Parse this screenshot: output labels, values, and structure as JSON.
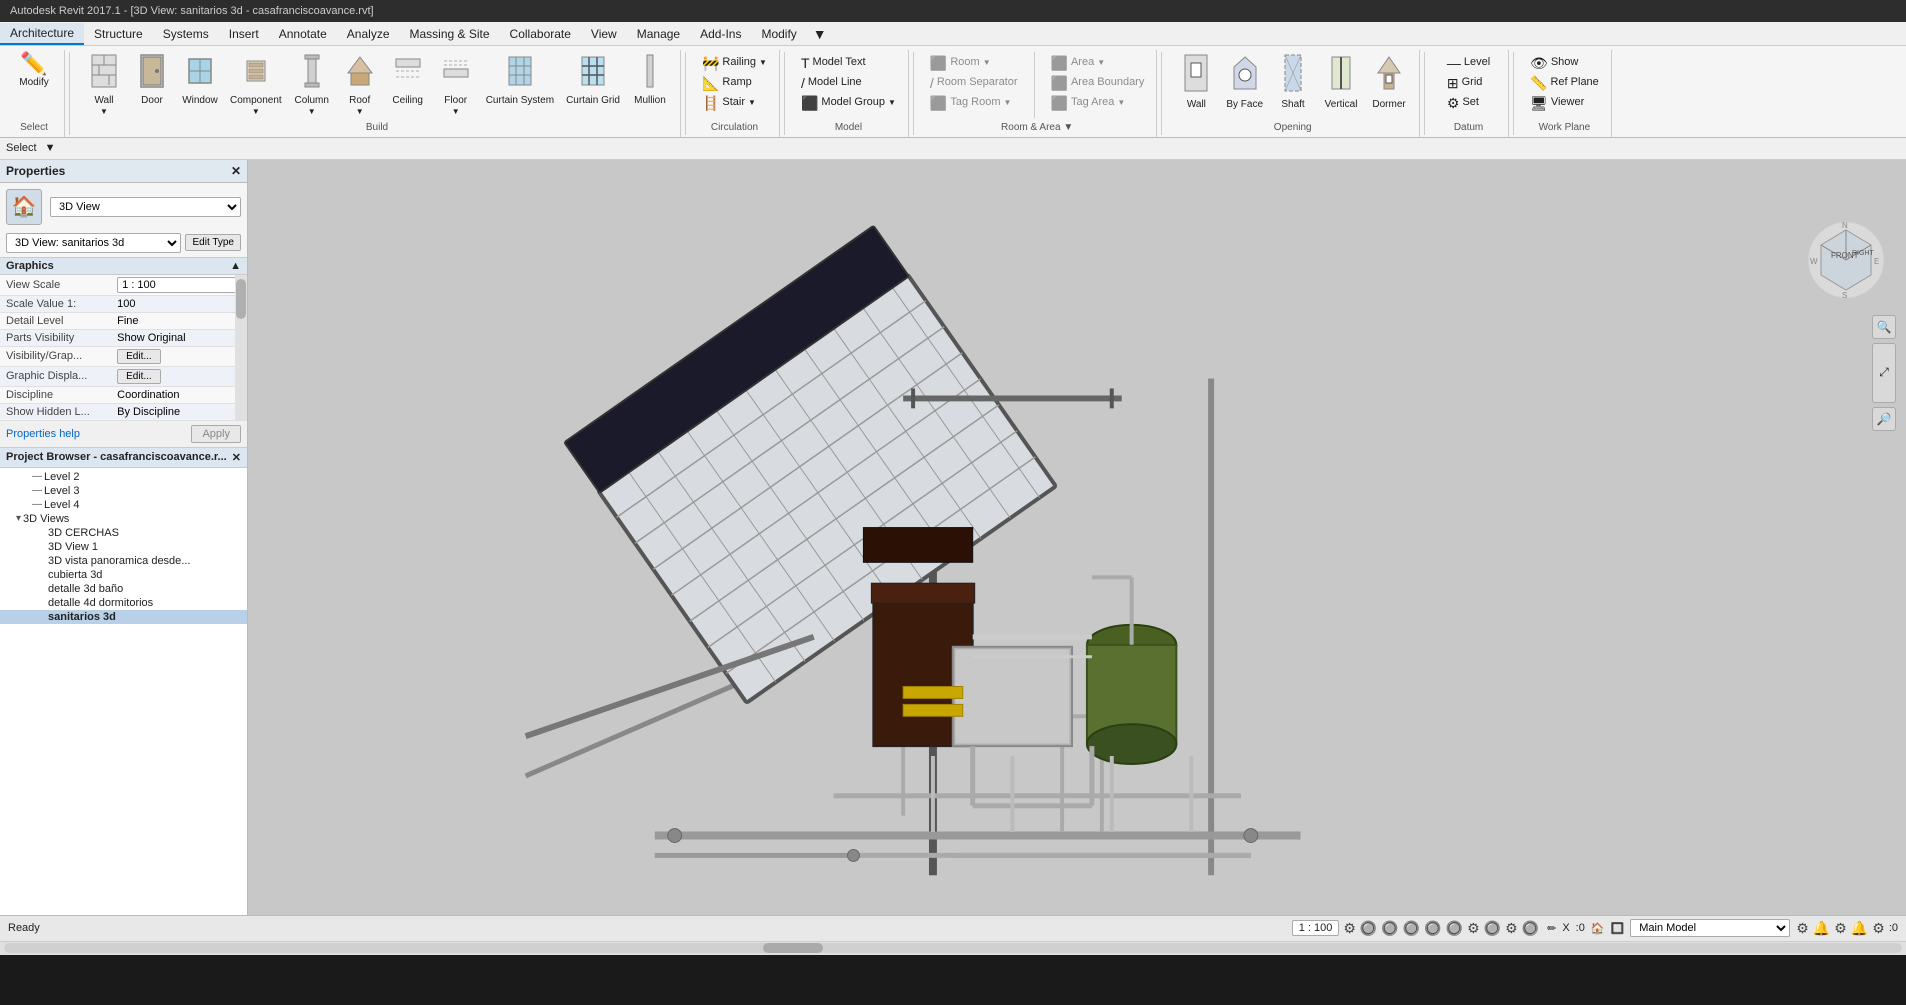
{
  "titlebar": {
    "text": "Autodesk Revit 2017.1 - [3D View: sanitarios 3d - casafranciscoavance.rvt]"
  },
  "menubar": {
    "items": [
      "Architecture",
      "Structure",
      "Systems",
      "Insert",
      "Annotate",
      "Analyze",
      "Massing & Site",
      "Collaborate",
      "View",
      "Manage",
      "Add-Ins",
      "Modify"
    ]
  },
  "ribbon": {
    "active_tab": "Architecture",
    "groups": [
      {
        "label": "Select",
        "buttons": [
          {
            "icon": "✏️",
            "label": "Modify",
            "type": "large"
          }
        ]
      },
      {
        "label": "Build",
        "buttons": [
          {
            "icon": "🧱",
            "label": "Wall",
            "type": "large"
          },
          {
            "icon": "🚪",
            "label": "Door",
            "type": "large"
          },
          {
            "icon": "🪟",
            "label": "Window",
            "type": "large"
          },
          {
            "icon": "⚙️",
            "label": "Component",
            "type": "large"
          },
          {
            "icon": "▮",
            "label": "Column",
            "type": "large"
          },
          {
            "icon": "🏠",
            "label": "Roof",
            "type": "large"
          },
          {
            "icon": "⬜",
            "label": "Ceiling",
            "type": "large"
          },
          {
            "icon": "📐",
            "label": "Floor",
            "type": "large"
          },
          {
            "icon": "▦",
            "label": "Curtain System",
            "type": "large"
          },
          {
            "icon": "▦",
            "label": "Curtain Grid",
            "type": "large"
          },
          {
            "icon": "▮",
            "label": "Mullion",
            "type": "large"
          }
        ]
      },
      {
        "label": "Circulation",
        "buttons": [
          {
            "icon": "⬛",
            "label": "Railing",
            "type": "small"
          },
          {
            "icon": "⬛",
            "label": "Ramp",
            "type": "small"
          },
          {
            "icon": "⬛",
            "label": "Stair",
            "type": "small"
          }
        ]
      },
      {
        "label": "Model",
        "buttons": [
          {
            "icon": "T",
            "label": "Model Text",
            "type": "small"
          },
          {
            "icon": "/",
            "label": "Model Line",
            "type": "small"
          },
          {
            "icon": "⬛",
            "label": "Model Group",
            "type": "small"
          }
        ]
      },
      {
        "label": "Room & Area",
        "buttons": [
          {
            "icon": "⬛",
            "label": "Room",
            "type": "small"
          },
          {
            "icon": "/",
            "label": "Room Separator",
            "type": "small"
          },
          {
            "icon": "⬛",
            "label": "Tag Room",
            "type": "small"
          },
          {
            "icon": "⬛",
            "label": "Area",
            "type": "small"
          },
          {
            "icon": "⬛",
            "label": "Area Boundary",
            "type": "small"
          },
          {
            "icon": "⬛",
            "label": "Tag Area",
            "type": "small"
          }
        ]
      },
      {
        "label": "Opening",
        "buttons": [
          {
            "icon": "⬛",
            "label": "Wall",
            "type": "small"
          },
          {
            "icon": "⬛",
            "label": "By Face",
            "type": "small"
          },
          {
            "icon": "⬛",
            "label": "Shaft",
            "type": "small"
          },
          {
            "icon": "⬛",
            "label": "Vertical",
            "type": "small"
          },
          {
            "icon": "⬛",
            "label": "Dormer",
            "type": "small"
          }
        ]
      },
      {
        "label": "Datum",
        "buttons": [
          {
            "icon": "⬛",
            "label": "Level",
            "type": "small"
          },
          {
            "icon": "⬛",
            "label": "Grid",
            "type": "small"
          },
          {
            "icon": "⬛",
            "label": "Set",
            "type": "small"
          }
        ]
      },
      {
        "label": "Work Plane",
        "buttons": [
          {
            "icon": "⬛",
            "label": "Show",
            "type": "small"
          },
          {
            "icon": "⬛",
            "label": "Ref Plane",
            "type": "small"
          },
          {
            "icon": "⬛",
            "label": "Viewer",
            "type": "small"
          }
        ]
      }
    ]
  },
  "select_bar": {
    "label": "Select",
    "dropdown_arrow": "▼"
  },
  "properties": {
    "title": "Properties",
    "close_icon": "✕",
    "type_icon": "🏠",
    "type_label": "3D View",
    "view_name": "3D View: sanitarios 3d",
    "edit_type_label": "Edit Type",
    "section_label": "Graphics",
    "section_arrow": "▲",
    "scroll_indicator": "▼",
    "rows": [
      {
        "label": "View Scale",
        "value": "1 : 100",
        "editable": true
      },
      {
        "label": "Scale Value  1:",
        "value": "100",
        "editable": false
      },
      {
        "label": "Detail Level",
        "value": "Fine",
        "editable": false
      },
      {
        "label": "Parts Visibility",
        "value": "Show Original",
        "editable": false
      },
      {
        "label": "Visibility/Grap...",
        "value": "Edit...",
        "editable": true
      },
      {
        "label": "Graphic Displa...",
        "value": "Edit...",
        "editable": true
      },
      {
        "label": "Discipline",
        "value": "Coordination",
        "editable": false
      },
      {
        "label": "Show Hidden L...",
        "value": "By Discipline",
        "editable": false
      }
    ],
    "help_link": "Properties help",
    "apply_btn": "Apply"
  },
  "project_browser": {
    "title": "Project Browser - casafranciscoavance.r...",
    "close_icon": "✕",
    "tree": [
      {
        "label": "Level 2",
        "indent": 2,
        "type": "item"
      },
      {
        "label": "Level 3",
        "indent": 2,
        "type": "item"
      },
      {
        "label": "Level 4",
        "indent": 2,
        "type": "item"
      },
      {
        "label": "3D Views",
        "indent": 1,
        "type": "group",
        "expanded": true
      },
      {
        "label": "3D CERCHAS",
        "indent": 3,
        "type": "item"
      },
      {
        "label": "3D View 1",
        "indent": 3,
        "type": "item"
      },
      {
        "label": "3D vista panoramica desde...",
        "indent": 3,
        "type": "item"
      },
      {
        "label": "cubierta 3d",
        "indent": 3,
        "type": "item"
      },
      {
        "label": "detalle 3d baño",
        "indent": 3,
        "type": "item"
      },
      {
        "label": "detalle 4d dormitorios",
        "indent": 3,
        "type": "item"
      },
      {
        "label": "sanitarios 3d",
        "indent": 3,
        "type": "item",
        "selected": true,
        "bold": true
      }
    ]
  },
  "viewport": {
    "green_indicator": true
  },
  "status_bar": {
    "ready": "Ready",
    "scale": "1 : 100",
    "x_coord": ":0",
    "model_label": "Main Model",
    "icons": [
      "⚙",
      "🔔",
      "⚙",
      "🔔",
      "⚙",
      "🔔",
      "⚙",
      "⚙",
      "⚙",
      ":0"
    ]
  },
  "viewcube": {
    "front_label": "FRONT",
    "right_label": "RIGHT"
  }
}
